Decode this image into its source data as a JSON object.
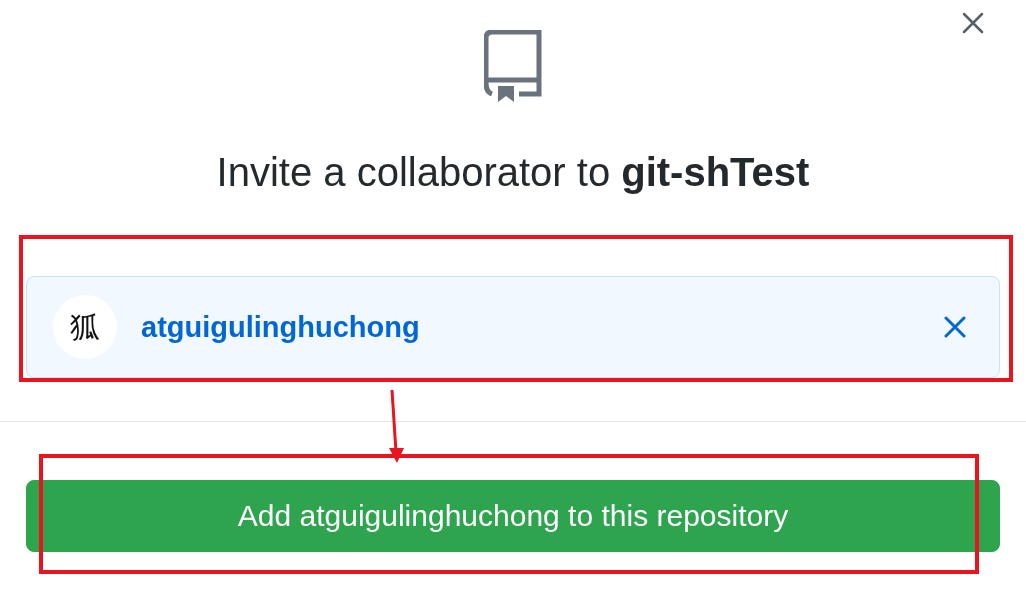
{
  "dialog": {
    "title": "Invite a collaborator to **git-shTest**"
  },
  "selected_user": {
    "avatar_text": "狐",
    "username": "atguigulinghuchong"
  },
  "add_button": {
    "label": "Add atguigulinghuchong to this repository"
  }
}
